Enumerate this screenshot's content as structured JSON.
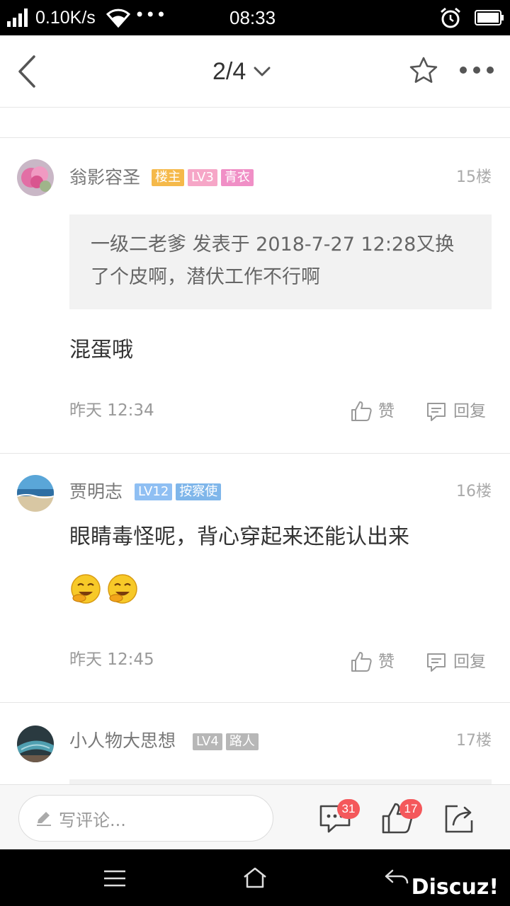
{
  "status_bar": {
    "speed": "0.10K/s",
    "dots": "•••",
    "time": "08:33"
  },
  "nav": {
    "page_indicator": "2/4"
  },
  "posts": [
    {
      "username": "翁影容圣",
      "badges": [
        {
          "text": "楼主",
          "color": "#f5b94a"
        },
        {
          "text": "LV3",
          "color": "#f6a6c7"
        },
        {
          "text": "青衣",
          "color": "#f08fc6"
        }
      ],
      "floor": "15楼",
      "quote": "一级二老爹 发表于 2018-7-27 12:28又换了个皮啊，潜伏工作不行啊",
      "content": "混蛋哦",
      "time": "昨天 12:34",
      "like_label": "赞",
      "reply_label": "回复"
    },
    {
      "username": "贾明志",
      "badges": [
        {
          "text": "LV12",
          "color": "#8fbff3"
        },
        {
          "text": "按察使",
          "color": "#7fb6ea"
        }
      ],
      "floor": "16楼",
      "content": "眼睛毒怪呢，背心穿起来还能认出来",
      "emojis": [
        "laughing-emoji",
        "laughing-emoji"
      ],
      "time": "昨天 12:45",
      "like_label": "赞",
      "reply_label": "回复"
    },
    {
      "username": "小人物大思想",
      "badges": [
        {
          "text": "LV4",
          "color": "#b7b7b7"
        },
        {
          "text": "路人",
          "color": "#b7b7b7"
        }
      ],
      "floor": "17楼"
    }
  ],
  "comment_bar": {
    "placeholder": "写评论...",
    "comment_count": "31",
    "like_count": "17"
  },
  "watermark": "Discuz!",
  "colors": {
    "badge_red": "#f4585b",
    "text_gray": "#999999",
    "separator": "#e6e6e6"
  }
}
